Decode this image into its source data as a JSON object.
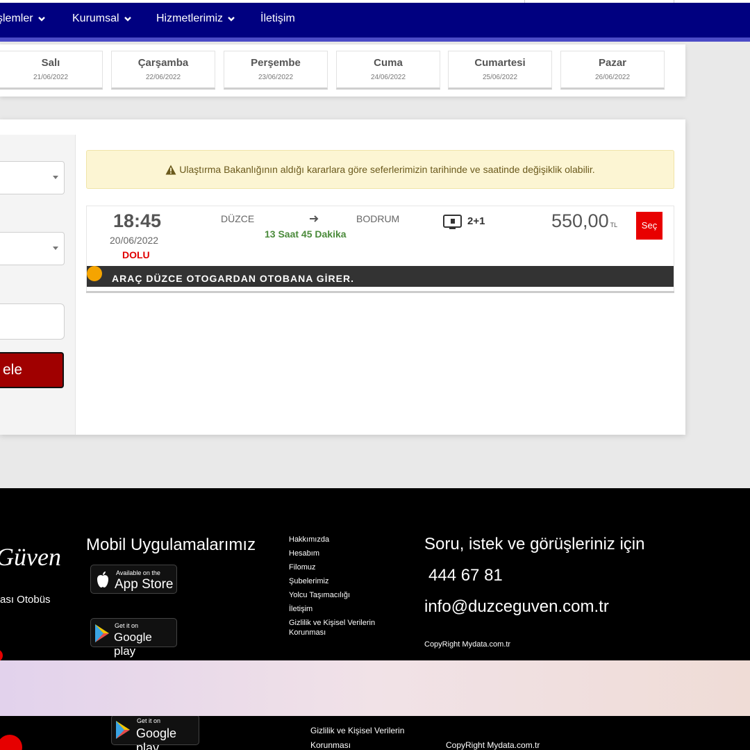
{
  "nav": {
    "items": [
      {
        "label": "şlemler"
      },
      {
        "label": "Kurumsal"
      },
      {
        "label": "Hizmetlerimiz"
      },
      {
        "label": "İletişim"
      }
    ]
  },
  "days": [
    {
      "name": "Salı",
      "date": "21/06/2022"
    },
    {
      "name": "Çarşamba",
      "date": "22/06/2022"
    },
    {
      "name": "Perşembe",
      "date": "23/06/2022"
    },
    {
      "name": "Cuma",
      "date": "24/06/2022"
    },
    {
      "name": "Cumartesi",
      "date": "25/06/2022"
    },
    {
      "name": "Pazar",
      "date": "26/06/2022"
    }
  ],
  "search": {
    "button_label": "ele"
  },
  "warning": {
    "text": "Ulaştırma Bakanlığının aldığı kararlara göre seferlerimizin tarihinde ve saatinde değişiklik olabilir."
  },
  "trip": {
    "time": "18:45",
    "date": "20/06/2022",
    "status": "DOLU",
    "from": "DÜZCE",
    "to": "BODRUM",
    "duration": "13 Saat 45 Dakika",
    "seat_layout": "2+1",
    "price": "550,00",
    "currency": "TL",
    "select_label": "Seç",
    "note": "ARAÇ DÜZCE OTOGARDAN OTOBANA GİRER."
  },
  "footer": {
    "brand": "Güven",
    "brand_sub": "ası Otobüs",
    "mobile_title": "Mobil Uygulamalarımız",
    "appstore_small": "Available on the",
    "appstore_big": "App Store",
    "googleplay_small": "Get it on",
    "googleplay_big": "Google play",
    "links": [
      "Hakkımızda",
      "Hesabım",
      "Filomuz",
      "Şubelerimiz",
      "Yolcu Taşımacılığı",
      "İletişim",
      "Gizlilik ve Kişisel Verilerin Korunması"
    ],
    "contact_title": "Soru, istek ve görüşleriniz için",
    "phone": "444 67 81",
    "email": "info@duzceguven.com.tr",
    "copyright": "CopyRight Mydata.com.tr"
  },
  "ghost": {
    "googleplay_small": "Get it on",
    "googleplay_big": "Google play",
    "link_line1": "Gizlilik ve Kişisel Verilerin",
    "link_line2": "Korunması",
    "copyright": "CopyRight Mydata.com.tr"
  },
  "colors": {
    "nav": "#000080",
    "select_button": "#e80000",
    "status_full": "#e00000",
    "duration": "#4a8a3a",
    "note_dot": "#f5a400"
  }
}
